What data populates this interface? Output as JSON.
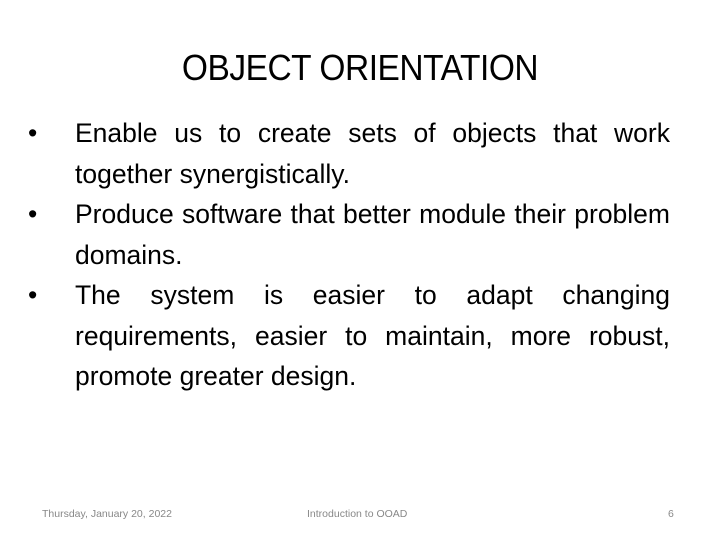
{
  "slide": {
    "title": "OBJECT ORIENTATION",
    "bullets": [
      "Enable us to create sets of objects that work together synergistically.",
      "Produce software that better module their problem domains.",
      "The system is easier to adapt changing requirements, easier to maintain, more robust, promote greater design."
    ],
    "bullet_glyph": "•"
  },
  "footer": {
    "date": "Thursday, January 20, 2022",
    "center": "Introduction to OOAD",
    "page_number": "6"
  }
}
